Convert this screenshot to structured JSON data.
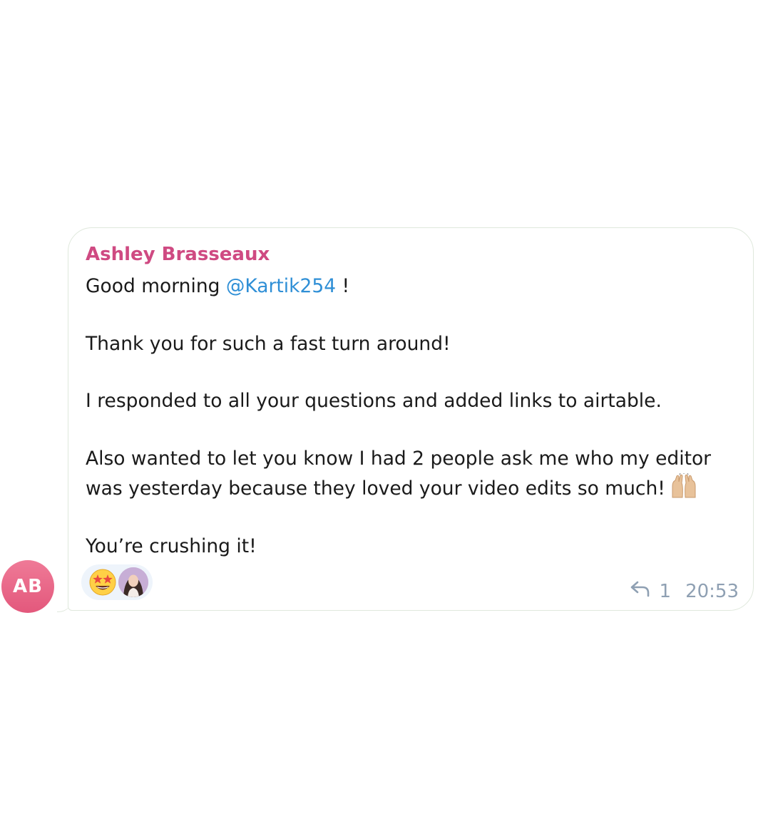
{
  "avatar": {
    "initials": "AB",
    "color": "#e8668a"
  },
  "message": {
    "sender": "Ashley Brasseaux",
    "sender_color": "#cf4a82",
    "greeting_prefix": "Good morning ",
    "mention": "@Kartik254",
    "greeting_suffix": " !",
    "line_thanks": "Thank you for such a fast turn around!",
    "line_responded": "I responded to all your questions and added links to airtable.",
    "line_also_1": "Also wanted to let you know I had 2 people ask me who my editor",
    "line_also_2": "was yesterday because they loved your video edits so much!",
    "line_crushing": "You’re crushing it!",
    "inline_emoji": "raising-hands-icon"
  },
  "reactions": {
    "emoji": "star-struck-icon",
    "reactor": "reactor-avatar"
  },
  "footer": {
    "reply_count": "1",
    "time": "20:53"
  }
}
